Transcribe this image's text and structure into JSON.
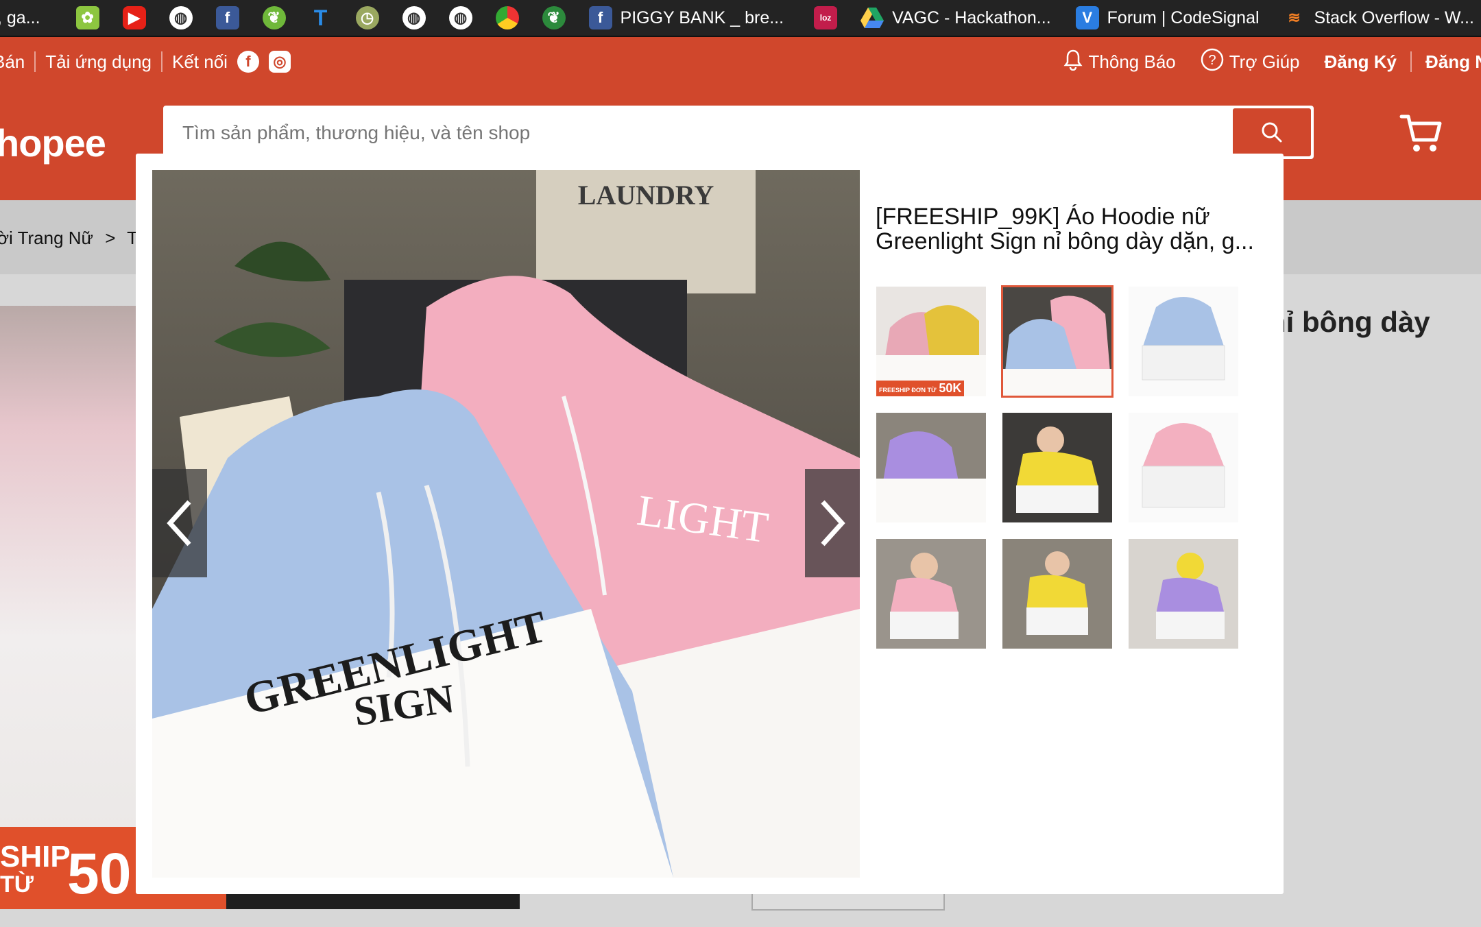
{
  "bookmarks": [
    {
      "label": ", ga...",
      "icon": "globe-icon"
    },
    {
      "label": "",
      "icon": "leaf-icon"
    },
    {
      "label": "",
      "icon": "youtube-icon"
    },
    {
      "label": "",
      "icon": "globe-icon"
    },
    {
      "label": "",
      "icon": "facebook-icon"
    },
    {
      "label": "",
      "icon": "sprout-icon"
    },
    {
      "label": "",
      "icon": "t-icon"
    },
    {
      "label": "",
      "icon": "clock-icon"
    },
    {
      "label": "",
      "icon": "globe-icon"
    },
    {
      "label": "",
      "icon": "globe-icon"
    },
    {
      "label": "",
      "icon": "chrome-icon"
    },
    {
      "label": "",
      "icon": "sprout-icon"
    },
    {
      "label": "PIGGY BANK _ bre...",
      "icon": "facebook-icon"
    },
    {
      "label": "",
      "icon": "loz-icon"
    },
    {
      "label": "VAGC - Hackathon...",
      "icon": "drive-icon"
    },
    {
      "label": "Forum | CodeSignal",
      "icon": "codesignal-icon"
    },
    {
      "label": "Stack Overflow - W...",
      "icon": "stackoverflow-icon"
    }
  ],
  "topnav": {
    "sell_label": "Bán",
    "app_label": "Tải ứng dụng",
    "connect_label": "Kết nối",
    "notifications_label": "Thông Báo",
    "help_label": "Trợ Giúp",
    "register_label": "Đăng Ký",
    "login_label": "Đăng N"
  },
  "logo_text": "hopee",
  "search": {
    "placeholder": "Tìm sản phẩm, thương hiệu, và tên shop"
  },
  "breadcrumb": {
    "category": "ời Trang Nữ",
    "sub": "Tra"
  },
  "background_title": "nỉ bông dày",
  "banner": {
    "line1": "SHIP",
    "line2": "TỪ",
    "amount": "50"
  },
  "modal": {
    "title_line1": "[FREESHIP_99K] Áo Hoodie nữ",
    "title_line2": "Greenlight Sign nỉ bông dày dặn, g...",
    "main_image_text_top": "GREENLIGHT",
    "main_image_text_bottom": "SIGN",
    "thumbnails": [
      {
        "badge": "FREESHIP ĐƠN TỪ",
        "badge_amount": "50K",
        "selected": false
      },
      {
        "badge": "",
        "badge_amount": "",
        "selected": true
      },
      {
        "badge": "",
        "badge_amount": "",
        "selected": false
      },
      {
        "badge": "",
        "badge_amount": "",
        "selected": false
      },
      {
        "badge": "",
        "badge_amount": "",
        "selected": false
      },
      {
        "badge": "",
        "badge_amount": "",
        "selected": false
      },
      {
        "badge": "",
        "badge_amount": "",
        "selected": false
      },
      {
        "badge": "",
        "badge_amount": "",
        "selected": false
      },
      {
        "badge": "",
        "badge_amount": "",
        "selected": false
      }
    ]
  },
  "colors": {
    "brand": "#d0472c",
    "selected_outline": "#e0583a"
  }
}
